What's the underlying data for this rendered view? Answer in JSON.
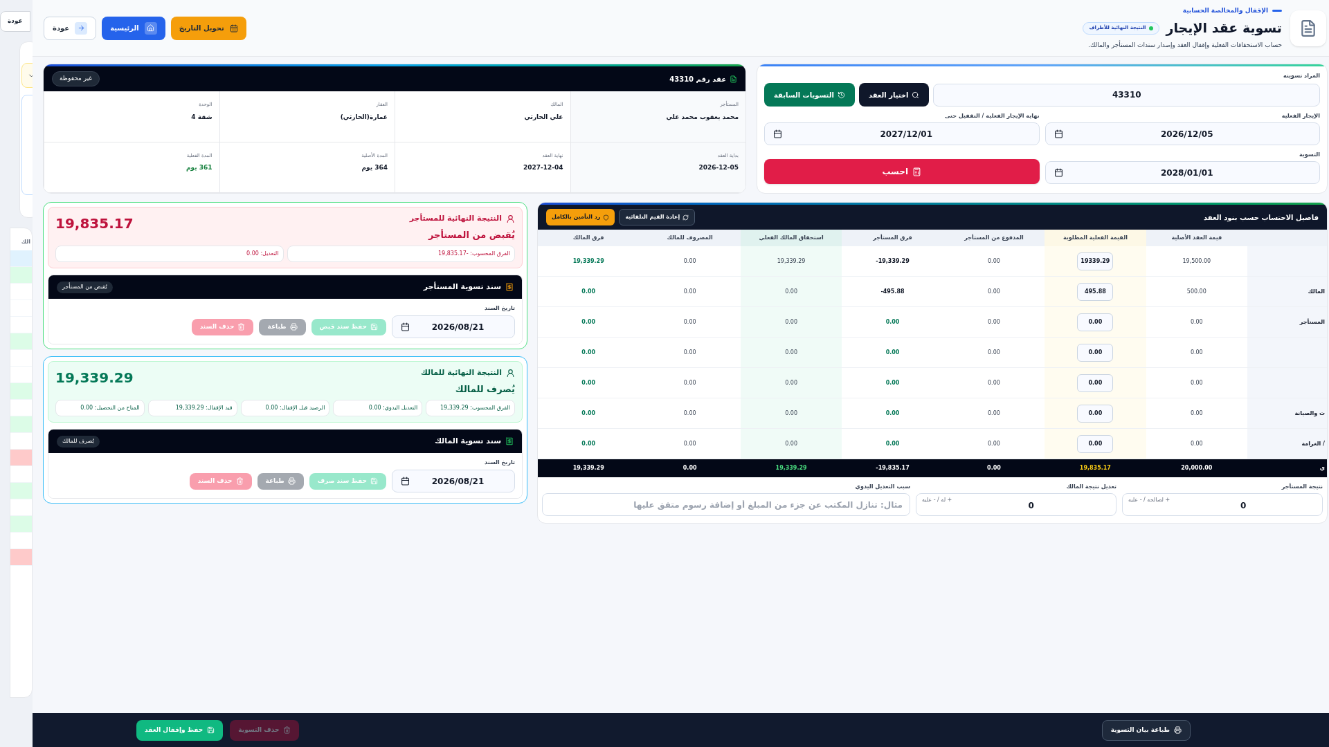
{
  "backdrop": {
    "button": "عودة",
    "label": "الك"
  },
  "header": {
    "breadcrumb": "الإقفال والمخالصة الحسابية",
    "title": "تسوية عقد الإيجار",
    "badge": "النتيجة النهائية للأطراف",
    "subtitle": "حساب الاستحقاقات الفعلية وإقفال العقد وإصدار سندات المستأجر والمالك."
  },
  "header_buttons": [
    {
      "label": "تحويل التاريخ",
      "kind": "convert"
    },
    {
      "label": "الرئيسية",
      "kind": "home"
    },
    {
      "label": "عودة",
      "kind": "back"
    }
  ],
  "form": {
    "contract_label": "المراد تسويته",
    "contract_value": "43310",
    "buttons": [
      {
        "label": "اختيار العقد",
        "kind": "select"
      },
      {
        "label": "التسويات السابقة",
        "kind": "history"
      }
    ],
    "start_label": "الإيجار الفعلية",
    "start_value": "2026/12/05",
    "end_label": "نهاية الإيجار الفعلية / التقفيل حتى",
    "end_value": "2027/12/01",
    "settle_label": "التسوية",
    "settle_value": "2028/01/01",
    "calc_button": "احسب"
  },
  "contract": {
    "title": "عقد رقم 43310",
    "status": "غير محفوظة",
    "fields": [
      {
        "label": "المستأجر",
        "value": "محمد يعقوب محمد علي",
        "kind": "plain"
      },
      {
        "label": "المالك",
        "value": "علي الحارثي",
        "kind": "plain"
      },
      {
        "label": "العقار",
        "value": "عمارة(الحارثي)",
        "kind": "plain"
      },
      {
        "label": "الوحدة",
        "value": "شقة 4",
        "kind": "plain"
      },
      {
        "label": "بداية العقد",
        "value": "2026-12-05",
        "kind": "plain"
      },
      {
        "label": "نهاية العقد",
        "value": "2027-12-04",
        "kind": "plain"
      },
      {
        "label": "المدة الأصلية",
        "value": "364 يوم",
        "kind": "plain"
      },
      {
        "label": "المدة الفعلية",
        "value": "361 يوم",
        "kind": "positive"
      }
    ]
  },
  "results": [
    {
      "kind": "tenant",
      "title": "النتيجة النهائية للمستأجر",
      "subtitle": "يُقبض من المستأجر",
      "amount": "19,835.17",
      "chips": [
        "الفرق المحسوب: -19,835.17",
        "التعديل: 0.00"
      ],
      "voucher": {
        "title": "سند تسوية المستأجر",
        "badge": "يُقبض من المستأجر",
        "date_label": "تاريخ السند",
        "date": "2026/08/21",
        "buttons": [
          {
            "label": "حفظ سند قبض",
            "kind": "save",
            "disabled": true
          },
          {
            "label": "طباعة",
            "kind": "print",
            "disabled": true
          },
          {
            "label": "حذف السند",
            "kind": "delete",
            "disabled": true
          }
        ]
      }
    },
    {
      "kind": "owner",
      "title": "النتيجة النهائية للمالك",
      "subtitle": "يُصرف للمالك",
      "amount": "19,339.29",
      "chips": [
        "الفرق المحسوب: 19,339.29",
        "التعديل اليدوي: 0.00",
        "الرصيد قبل الإقفال: 0.00",
        "قيد الإقفال: 19,339.29",
        "المتاح من التحصيل: 0.00"
      ],
      "voucher": {
        "title": "سند تسوية المالك",
        "badge": "يُصرف للمالك",
        "date_label": "تاريخ السند",
        "date": "2026/08/21",
        "buttons": [
          {
            "label": "حفظ سند صرف",
            "kind": "save",
            "disabled": true
          },
          {
            "label": "طباعة",
            "kind": "print",
            "disabled": true
          },
          {
            "label": "حذف السند",
            "kind": "delete",
            "disabled": true
          }
        ]
      }
    }
  ],
  "table": {
    "title": "فاصيل الاحتساب حسب بنود العقد",
    "buttons": [
      {
        "label": "إعادة القيم التلقائية",
        "kind": "reset"
      },
      {
        "label": "رد التأمين بالكامل",
        "kind": "refund"
      }
    ],
    "columns": [
      "قيمة العقد الأصلية",
      "القيمة الفعلية المطلوبة",
      "المدفوع من المستأجر",
      "فرق المستأجر",
      "استحقاق المالك الفعلي",
      "المصروف للمالك",
      "فرق المالك"
    ],
    "rows": [
      {
        "original": "19,500.00",
        "actual": "19339.29",
        "paid": "0.00",
        "tenant_diff": "-19,339.29",
        "tenant_settled": false,
        "owner_due": "19,339.29",
        "owner_paid": "0.00",
        "owner_diff": "19,339.29"
      },
      {
        "label": "المالك",
        "original": "500.00",
        "actual": "495.88",
        "paid": "0.00",
        "tenant_diff": "-495.88",
        "tenant_settled": false,
        "owner_due": "0.00",
        "owner_paid": "0.00",
        "owner_diff": "0.00"
      },
      {
        "label": "المستأجر",
        "original": "0.00",
        "actual": "0.00",
        "paid": "0.00",
        "tenant_diff": "0.00",
        "tenant_settled": true,
        "owner_due": "0.00",
        "owner_paid": "0.00",
        "owner_diff": "0.00"
      },
      {
        "original": "0.00",
        "actual": "0.00",
        "paid": "0.00",
        "tenant_diff": "0.00",
        "tenant_settled": true,
        "owner_due": "0.00",
        "owner_paid": "0.00",
        "owner_diff": "0.00"
      },
      {
        "original": "0.00",
        "actual": "0.00",
        "paid": "0.00",
        "tenant_diff": "0.00",
        "tenant_settled": true,
        "owner_due": "0.00",
        "owner_paid": "0.00",
        "owner_diff": "0.00"
      },
      {
        "label": "ت والصيانة",
        "original": "0.00",
        "actual": "0.00",
        "paid": "0.00",
        "tenant_diff": "0.00",
        "tenant_settled": true,
        "owner_due": "0.00",
        "owner_paid": "0.00",
        "owner_diff": "0.00"
      },
      {
        "label": "/ الغرامة",
        "original": "0.00",
        "actual": "0.00",
        "paid": "0.00",
        "tenant_diff": "0.00",
        "tenant_settled": true,
        "owner_due": "0.00",
        "owner_paid": "0.00",
        "owner_diff": "0.00"
      }
    ],
    "total": {
      "label": "ي",
      "original": "20,000.00",
      "actual": "19,835.17",
      "paid": "0.00",
      "tenant_diff": "-19,835.17",
      "owner_due": "19,339.29",
      "owner_paid": "0.00",
      "owner_diff": "19,339.29"
    },
    "adjustments": {
      "tenant": {
        "label": "نتيجة المستأجر",
        "hint": "+ لصالحه / - عليه",
        "value": "0"
      },
      "owner": {
        "label": "تعديل نتيجة المالك",
        "hint": "+ له / - عليه",
        "value": "0"
      },
      "reason": {
        "label": "سبب التعديل اليدوي",
        "placeholder": "مثال: تنازل المكتب عن جزء من المبلغ أو إضافة رسوم متفق عليها"
      }
    }
  },
  "footer": {
    "buttons": [
      {
        "label": "طباعة بيان التسوية",
        "kind": "print",
        "disabled": false
      },
      {
        "label": "حذف التسوية",
        "kind": "delete",
        "disabled": true
      },
      {
        "label": "حفظ وإقفال العقد",
        "kind": "save",
        "disabled": false
      }
    ]
  }
}
